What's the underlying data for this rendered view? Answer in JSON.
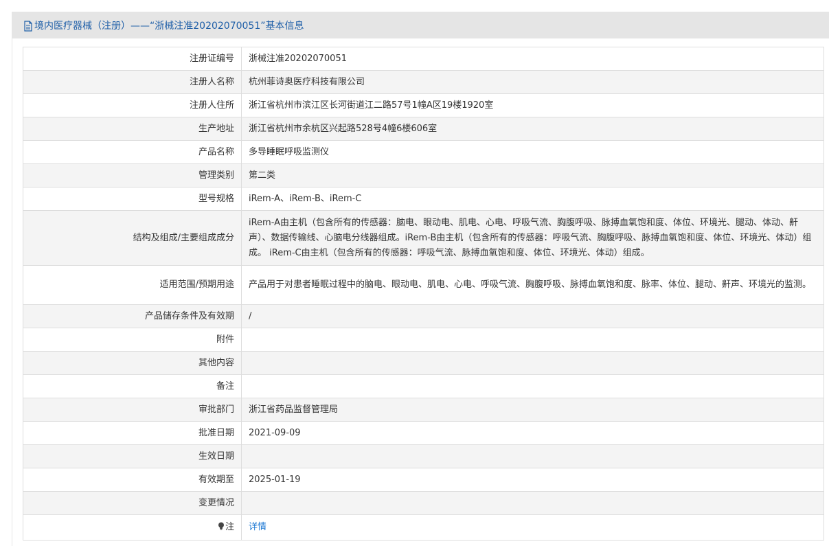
{
  "header": {
    "title": "境内医疗器械（注册）——“浙械注准20202070051”基本信息",
    "icon": "document-icon",
    "color": "#1f5fa8"
  },
  "rows": [
    {
      "label": "注册证编号",
      "value": "浙械注准20202070051"
    },
    {
      "label": "注册人名称",
      "value": "杭州菲诗奥医疗科技有限公司"
    },
    {
      "label": "注册人住所",
      "value": "浙江省杭州市滨江区长河街道江二路57号1幢A区19楼1920室"
    },
    {
      "label": "生产地址",
      "value": "浙江省杭州市余杭区兴起路528号4幢6楼606室"
    },
    {
      "label": "产品名称",
      "value": "多导睡眠呼吸监测仪"
    },
    {
      "label": "管理类别",
      "value": "第二类"
    },
    {
      "label": "型号规格",
      "value": "iRem-A、iRem-B、iRem-C"
    },
    {
      "label": "结构及组成/主要组成成分",
      "value": "iRem-A由主机（包含所有的传感器：脑电、眼动电、肌电、心电、呼吸气流、胸腹呼吸、脉搏血氧饱和度、体位、环境光、腿动、体动、鼾声）、数据传输线、心脑电分线器组成。iRem-B由主机（包含所有的传感器：呼吸气流、胸腹呼吸、脉搏血氧饱和度、体位、环境光、体动）组成。 iRem-C由主机（包含所有的传感器：呼吸气流、脉搏血氧饱和度、体位、环境光、体动）组成。"
    },
    {
      "label": "适用范围/预期用途",
      "value": "产品用于对患者睡眠过程中的脑电、眼动电、肌电、心电、呼吸气流、胸腹呼吸、脉搏血氧饱和度、脉率、体位、腿动、鼾声、环境光的监测。"
    },
    {
      "label": "产品储存条件及有效期",
      "value": "/"
    },
    {
      "label": "附件",
      "value": ""
    },
    {
      "label": "其他内容",
      "value": ""
    },
    {
      "label": "备注",
      "value": ""
    },
    {
      "label": "审批部门",
      "value": "浙江省药品监督管理局"
    },
    {
      "label": "批准日期",
      "value": "2021-09-09"
    },
    {
      "label": "生效日期",
      "value": ""
    },
    {
      "label": "有效期至",
      "value": "2025-01-19"
    },
    {
      "label": "变更情况",
      "value": ""
    }
  ],
  "note": {
    "icon": "lightbulb-icon",
    "label": "注",
    "link_text": "详情",
    "link_color": "#1f7ad4"
  }
}
